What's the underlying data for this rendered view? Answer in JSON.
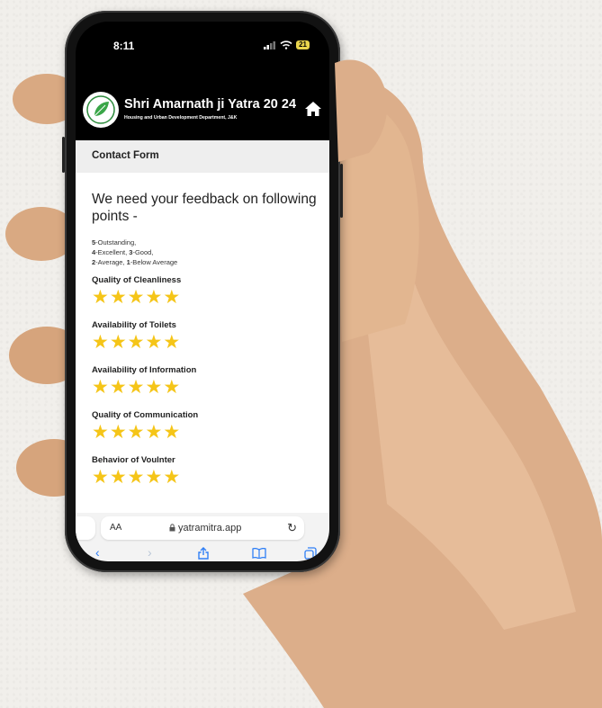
{
  "status": {
    "time": "8:11",
    "battery": "21"
  },
  "app": {
    "title": "Shri Amarnath ji Yatra 20 24",
    "subtitle": "Housing and Urban Development Department, J&K"
  },
  "section": {
    "title": "Contact Form"
  },
  "form": {
    "heading": "We need your feedback on following points -",
    "scale_lines": [
      [
        {
          "num": "5",
          "text": "-Outstanding,"
        }
      ],
      [
        {
          "num": "4",
          "text": "-Excellent, "
        },
        {
          "num": "3",
          "text": "-Good,"
        }
      ],
      [
        {
          "num": "2",
          "text": "-Average, "
        },
        {
          "num": "1",
          "text": "-Below Average"
        }
      ]
    ],
    "questions": [
      {
        "label": "Quality of Cleanliness",
        "rating": 5,
        "max": 5
      },
      {
        "label": "Availability of Toilets",
        "rating": 5,
        "max": 5
      },
      {
        "label": "Availability of Information",
        "rating": 5,
        "max": 5
      },
      {
        "label": "Quality of Communication",
        "rating": 5,
        "max": 5
      },
      {
        "label": "Behavior of Voulnter",
        "rating": 5,
        "max": 5
      }
    ]
  },
  "browser": {
    "aa_label": "AA",
    "url": "yatramitra.app",
    "icons": [
      "back-icon",
      "forward-icon",
      "share-icon",
      "bookmarks-icon",
      "tabs-icon"
    ]
  },
  "colors": {
    "star": "#f5c518",
    "accent": "#2f7ff6",
    "header_bg": "#000000"
  }
}
